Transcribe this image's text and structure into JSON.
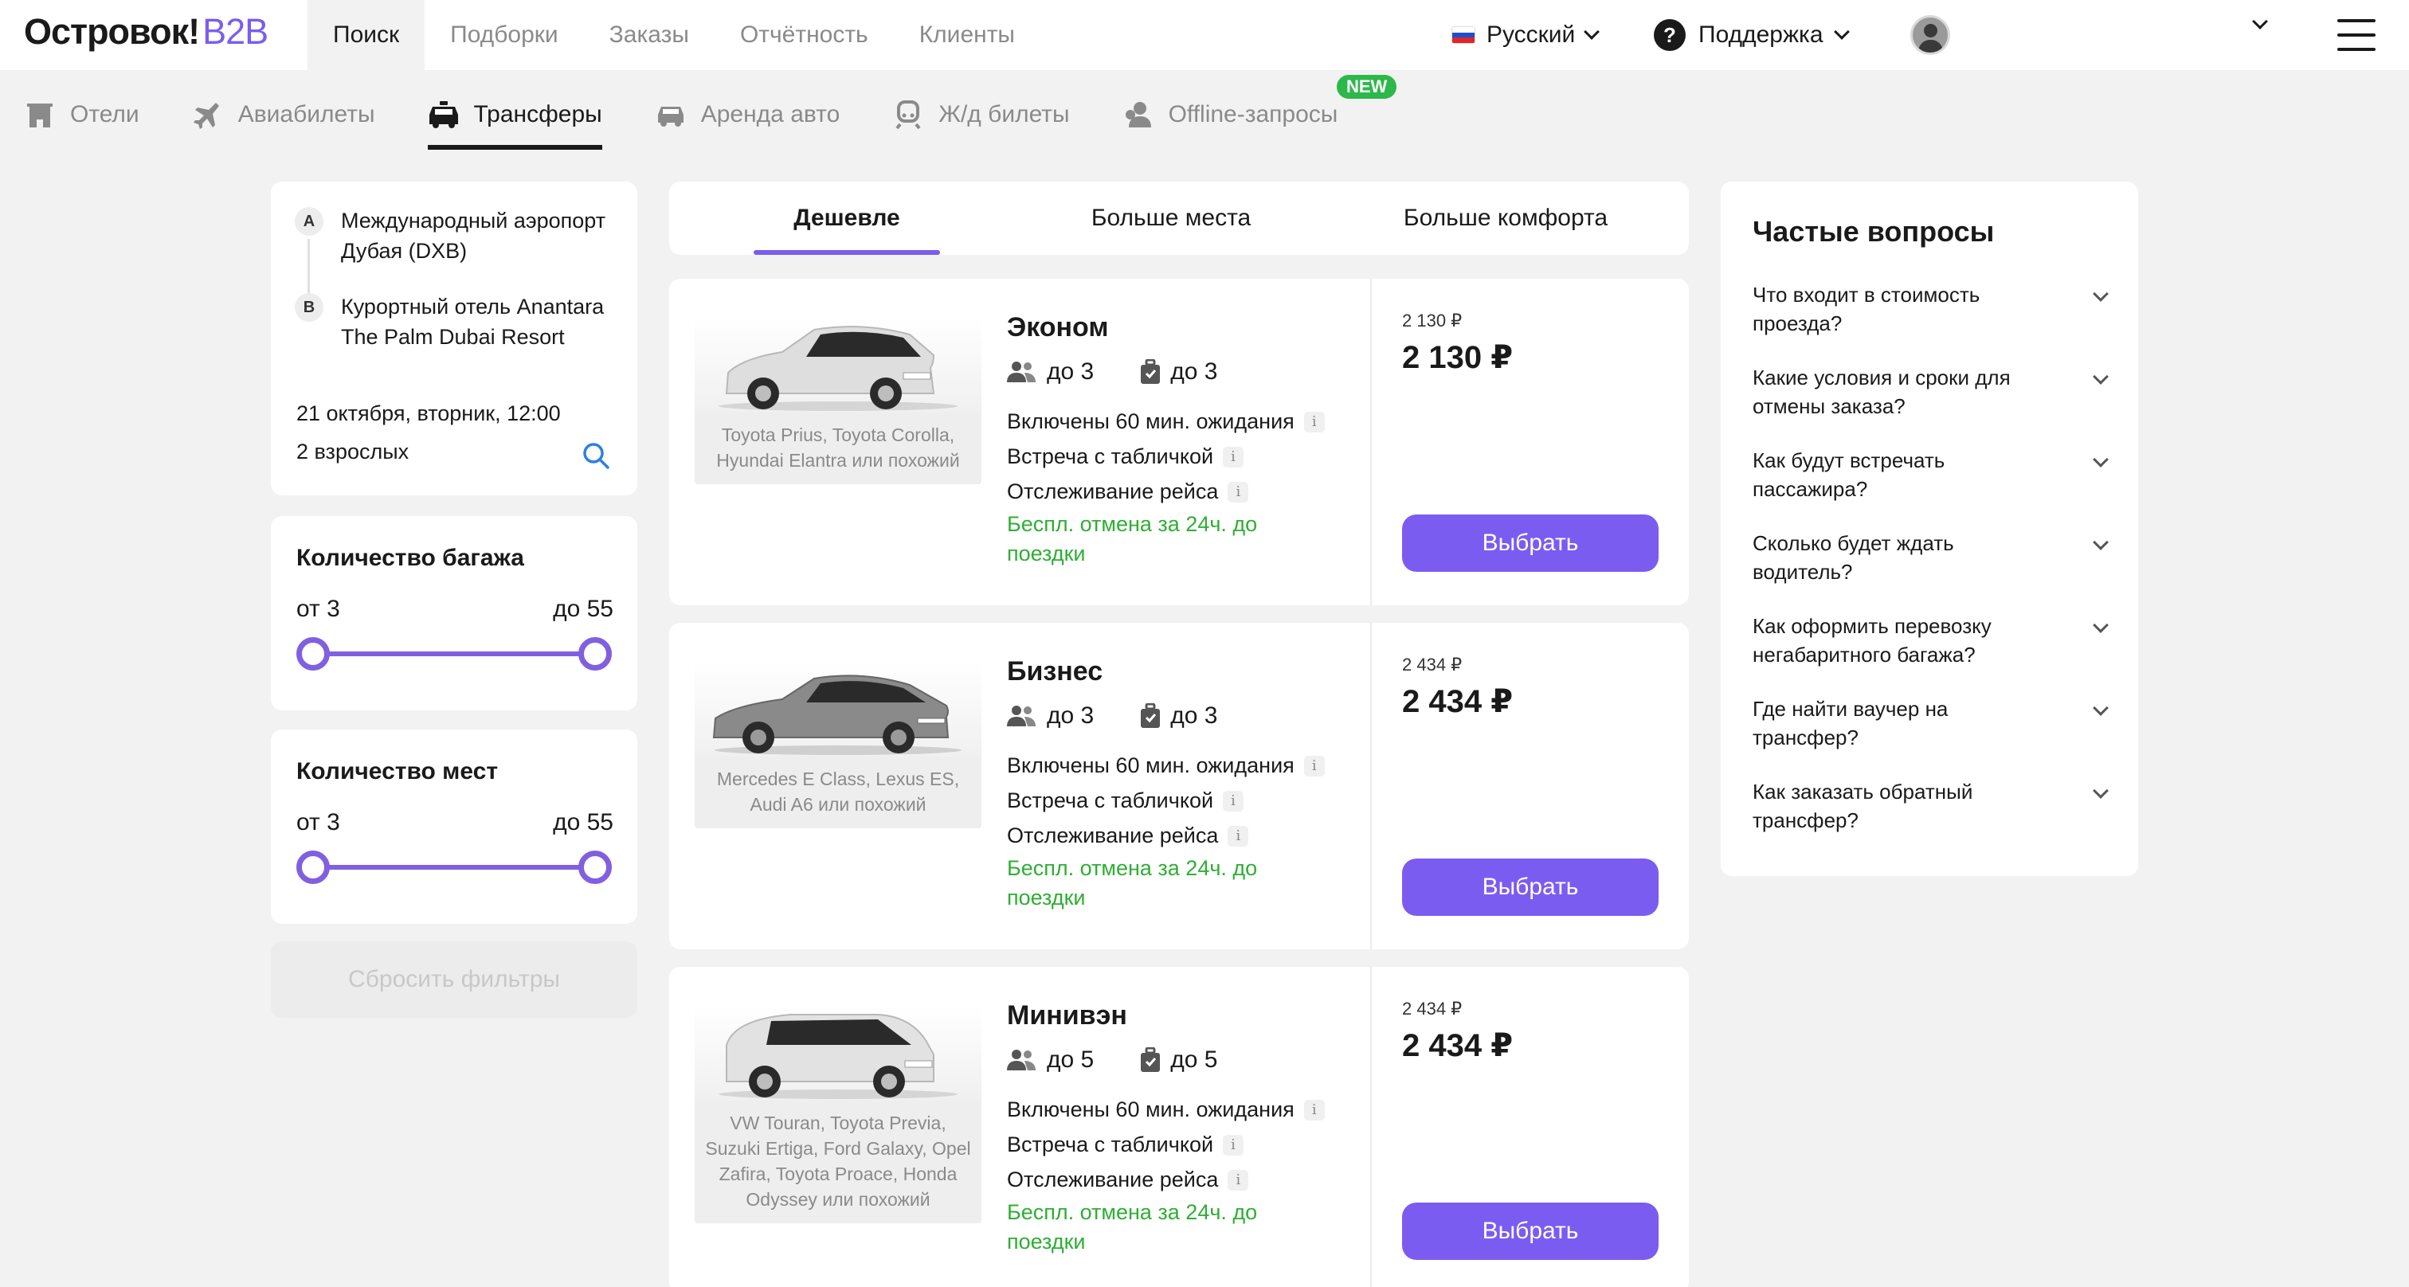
{
  "header": {
    "logo_main": "Островок!",
    "logo_accent": "B2B",
    "nav": [
      "Поиск",
      "Подборки",
      "Заказы",
      "Отчётность",
      "Клиенты"
    ],
    "language": "Русский",
    "support": "Поддержка"
  },
  "subtabs": [
    "Отели",
    "Авиабилеты",
    "Трансферы",
    "Аренда авто",
    "Ж/д билеты",
    "Offline-запросы"
  ],
  "new_badge": "NEW",
  "route": {
    "point_a_label": "A",
    "point_a": "Международный аэропорт Дубая (DXB)",
    "point_b_label": "B",
    "point_b": "Курортный отель Anantara The Palm Dubai Resort",
    "date": "21 октября, вторник, 12:00",
    "passengers": "2 взрослых"
  },
  "filters": [
    {
      "title": "Количество багажа",
      "from": "от 3",
      "to": "до 55"
    },
    {
      "title": "Количество мест",
      "from": "от 3",
      "to": "до 55"
    }
  ],
  "reset_filters": "Сбросить фильтры",
  "sort_tabs": [
    "Дешевле",
    "Больше места",
    "Больше комфорта"
  ],
  "offers": [
    {
      "title": "Эконом",
      "models": "Toyota Prius, Toyota Corolla, Hyundai Elantra или похожий",
      "passengers": "до 3",
      "luggage": "до 3",
      "features": [
        "Включены 60 мин. ожидания",
        "Встреча с табличкой",
        "Отслеживание рейса"
      ],
      "cancel": "Беспл. отмена за 24ч. до поездки",
      "old_price": "2 130 ₽",
      "price": "2 130 ₽",
      "button": "Выбрать"
    },
    {
      "title": "Бизнес",
      "models": "Mercedes E Class, Lexus ES, Audi A6 или похожий",
      "passengers": "до 3",
      "luggage": "до 3",
      "features": [
        "Включены 60 мин. ожидания",
        "Встреча с табличкой",
        "Отслеживание рейса"
      ],
      "cancel": "Беспл. отмена за 24ч. до поездки",
      "old_price": "2 434 ₽",
      "price": "2 434 ₽",
      "button": "Выбрать"
    },
    {
      "title": "Минивэн",
      "models": "VW Touran, Toyota Previa, Suzuki Ertiga, Ford Galaxy, Opel Zafira, Toyota Proace, Honda Odyssey или похожий",
      "passengers": "до 5",
      "luggage": "до 5",
      "features": [
        "Включены 60 мин. ожидания",
        "Встреча с табличкой",
        "Отслеживание рейса"
      ],
      "cancel": "Беспл. отмена за 24ч. до поездки",
      "old_price": "2 434 ₽",
      "price": "2 434 ₽",
      "button": "Выбрать"
    }
  ],
  "faq": {
    "title": "Частые вопросы",
    "items": [
      "Что входит в стоимость проезда?",
      "Какие условия и сроки для отмены заказа?",
      "Как будут встречать пассажира?",
      "Сколько будет ждать водитель?",
      "Как оформить перевозку негабаритного багажа?",
      "Где найти ваучер на трансфер?",
      "Как заказать обратный трансфер?"
    ]
  },
  "colors": {
    "accent": "#7b5cf0",
    "success": "#2fae34",
    "new_badge": "#2db84b",
    "background": "#f2f2f2"
  },
  "icons": [
    "hotel-icon",
    "plane-icon",
    "bus-icon",
    "car-icon",
    "train-icon",
    "person-icon",
    "question-icon",
    "search-icon",
    "chevron-down-icon",
    "burger-icon",
    "passengers-icon",
    "luggage-icon",
    "info-icon"
  ]
}
